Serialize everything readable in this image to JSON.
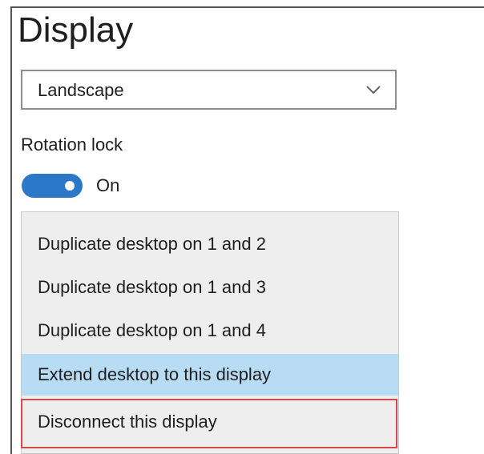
{
  "page": {
    "title": "Display"
  },
  "orientation": {
    "selected": "Landscape",
    "icon": "chevron-down-icon"
  },
  "rotation_lock": {
    "label": "Rotation lock",
    "state": "On",
    "is_on": true
  },
  "display_menu": {
    "items": [
      {
        "label": "Duplicate desktop on 1 and 2",
        "highlighted": false,
        "outlined": false
      },
      {
        "label": "Duplicate desktop on 1 and 3",
        "highlighted": false,
        "outlined": false
      },
      {
        "label": "Duplicate desktop on 1 and 4",
        "highlighted": false,
        "outlined": false
      },
      {
        "label": "Extend desktop to this display",
        "highlighted": true,
        "outlined": false
      },
      {
        "label": "Disconnect this display",
        "highlighted": false,
        "outlined": true
      }
    ]
  },
  "colors": {
    "accent": "#2b78c8",
    "highlight": "#b7dcf4",
    "outline": "#d24a4a"
  }
}
